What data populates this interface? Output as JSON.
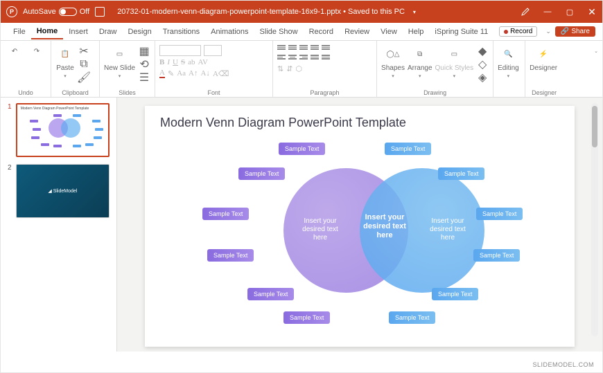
{
  "titlebar": {
    "autosave_label": "AutoSave",
    "autosave_state": "Off",
    "filename": "20732-01-modern-venn-diagram-powerpoint-template-16x9-1.pptx • Saved to this PC"
  },
  "tabs": {
    "file": "File",
    "home": "Home",
    "insert": "Insert",
    "draw": "Draw",
    "design": "Design",
    "transitions": "Transitions",
    "animations": "Animations",
    "slideshow": "Slide Show",
    "record": "Record",
    "review": "Review",
    "view": "View",
    "help": "Help",
    "ispring": "iSpring Suite 11",
    "record_btn": "Record",
    "share_btn": "Share"
  },
  "ribbon": {
    "undo_group": "Undo",
    "clipboard_group": "Clipboard",
    "paste": "Paste",
    "slides_group": "Slides",
    "new_slide": "New Slide",
    "font_group": "Font",
    "paragraph_group": "Paragraph",
    "drawing_group": "Drawing",
    "shapes": "Shapes",
    "arrange": "Arrange",
    "quick_styles": "Quick Styles",
    "editing": "Editing",
    "designer_group": "Designer",
    "designer": "Designer",
    "bold": "B",
    "italic": "I",
    "underline": "U",
    "strike": "S"
  },
  "thumbs": {
    "n1": "1",
    "n2": "2",
    "t1_title": "Modern Venn Diagram PowerPoint Template",
    "t2_label": "SlideModel"
  },
  "slide": {
    "title": "Modern Venn Diagram PowerPoint Template",
    "circle_left": "Insert your desired text here",
    "circle_center": "Insert your desired text here",
    "circle_right": "Insert your desired text here",
    "sample": "Sample Text"
  },
  "watermark": "SLIDEMODEL.COM"
}
